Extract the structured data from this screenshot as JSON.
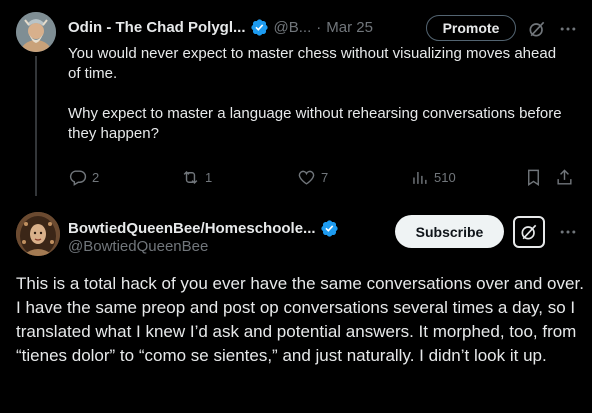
{
  "colors": {
    "background": "#000000",
    "text": "#e7e9ea",
    "muted": "#71767b",
    "verified": "#1d9bf0",
    "subscribe_bg": "#eff3f4"
  },
  "parent_tweet": {
    "author_name": "Odin - The Chad Polygl...",
    "handle": "@B...",
    "separator": "·",
    "date": "Mar 25",
    "promote_label": "Promote",
    "text_paragraph_1": "You would never expect to master chess without visualizing moves ahead of time.",
    "text_paragraph_2": "Why expect to master a language without rehearsing conversations before they happen?",
    "stats": {
      "replies": "2",
      "reposts": "1",
      "likes": "7",
      "views": "510"
    },
    "icons": [
      "verified-icon",
      "grok-icon",
      "more-icon",
      "reply-icon",
      "repost-icon",
      "like-icon",
      "views-icon",
      "bookmark-icon",
      "share-icon"
    ]
  },
  "reply": {
    "author_name": "BowtiedQueenBee/Homeschoole...",
    "handle": "@BowtiedQueenBee",
    "subscribe_label": "Subscribe",
    "text": "This is a total hack of you ever have the same conversations over and over. I have the same preop and post op conversations several times a day, so I translated what I knew I’d ask and potential answers. It morphed, too, from “tienes dolor” to “como se sientes,” and just naturally. I didn’t look it up.",
    "icons": [
      "verified-icon",
      "grok-icon",
      "more-icon"
    ]
  }
}
